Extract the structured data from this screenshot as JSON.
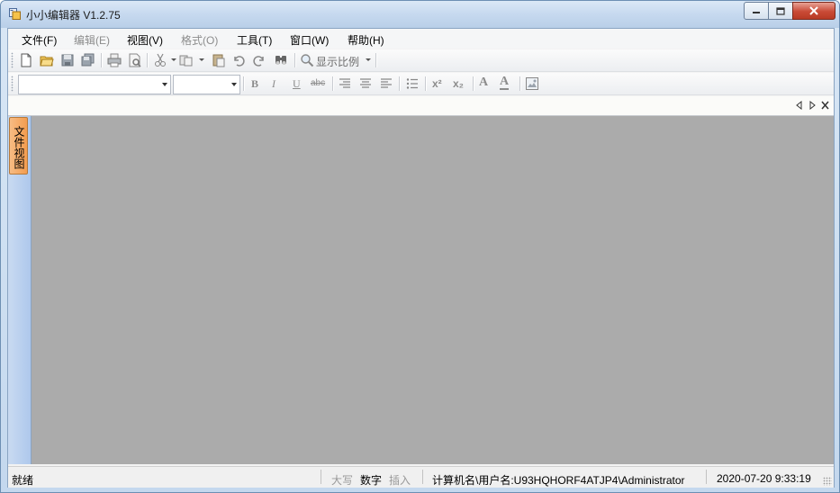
{
  "window": {
    "title": "小小编辑器 V1.2.75"
  },
  "menubar": {
    "items": [
      {
        "label": "文件(F)",
        "enabled": true
      },
      {
        "label": "编辑(E)",
        "enabled": false
      },
      {
        "label": "视图(V)",
        "enabled": true
      },
      {
        "label": "格式(O)",
        "enabled": false
      },
      {
        "label": "工具(T)",
        "enabled": true
      },
      {
        "label": "窗口(W)",
        "enabled": true
      },
      {
        "label": "帮助(H)",
        "enabled": true
      }
    ]
  },
  "toolbar": {
    "zoom_label": "显示比例",
    "font_name_value": "",
    "font_size_value": "",
    "bold_label": "B",
    "italic_label": "I",
    "underline_label": "U",
    "strike_label": "abc",
    "superscript_label": "x²",
    "subscript_label": "x₂",
    "font_color_label": "A",
    "highlight_label": "A"
  },
  "side_panel": {
    "tab_label": "文件视图"
  },
  "statusbar": {
    "ready": "就绪",
    "caps": "大写",
    "num": "数字",
    "insert": "插入",
    "user_info": "计算机名\\用户名:U93HQHORF4ATJP4\\Administrator",
    "datetime": "2020-07-20 9:33:19"
  },
  "colors": {
    "workarea": "#ababab",
    "file_tab": "#f5a866",
    "side_panel": "#b9d0ee"
  }
}
